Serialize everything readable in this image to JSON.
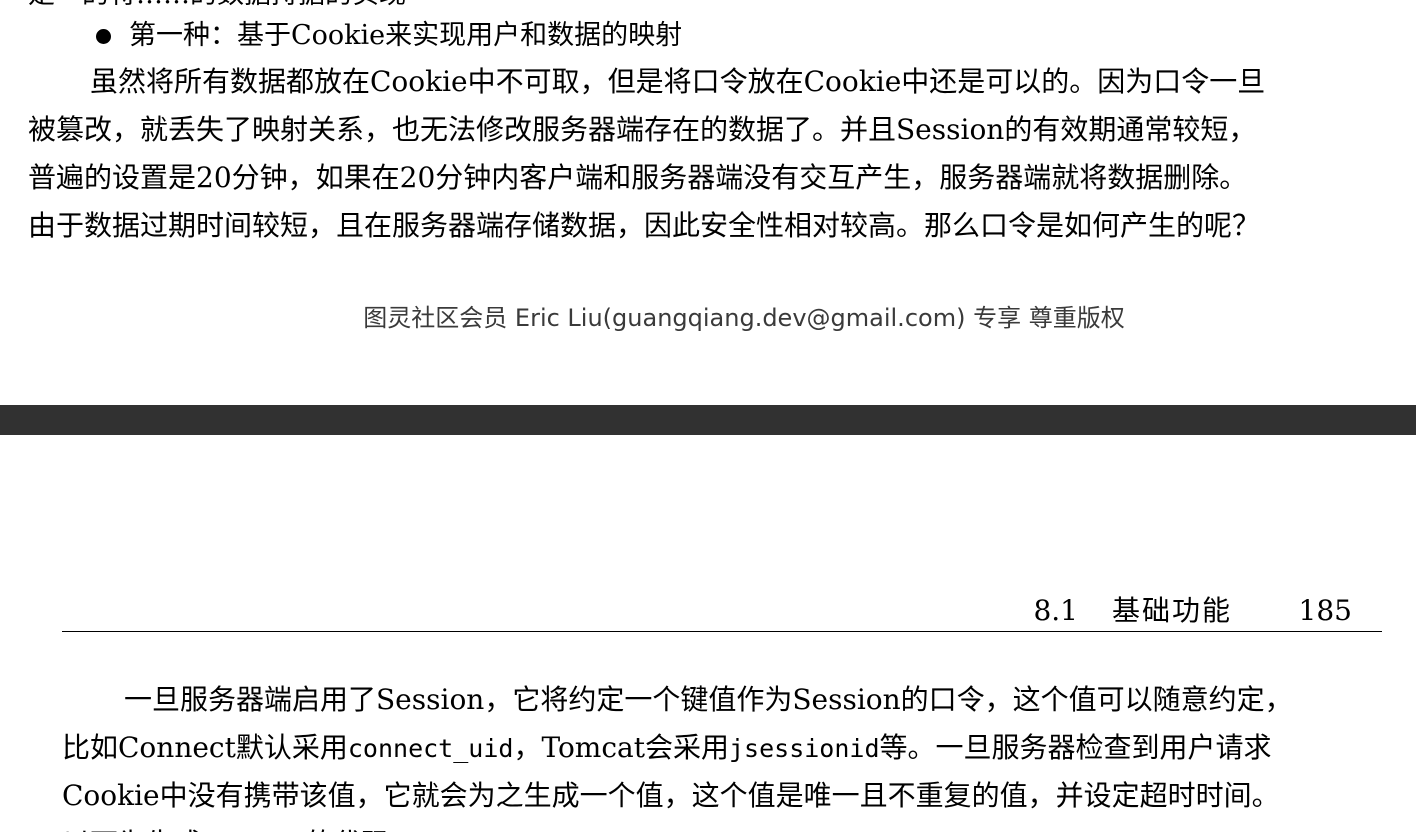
{
  "top_page": {
    "cut_line": "是一的将……的数据持据的实现",
    "bullet": "第一种：基于Cookie来实现用户和数据的映射",
    "paragraph": [
      "虽然将所有数据都放在Cookie中不可取，但是将口令放在Cookie中还是可以的。因为口令一旦",
      "被篡改，就丢失了映射关系，也无法修改服务器端存在的数据了。并且Session的有效期通常较短，",
      "普遍的设置是20分钟，如果在20分钟内客户端和服务器端没有交互产生，服务器端就将数据删除。",
      "由于数据过期时间较短，且在服务器端存储数据，因此安全性相对较高。那么口令是如何产生的呢？"
    ],
    "watermark": "图灵社区会员 Eric Liu(guangqiang.dev@gmail.com) 专享 尊重版权"
  },
  "bottom_page": {
    "header": {
      "section_number": "8.1",
      "section_title": "基础功能",
      "page_number": "185"
    },
    "line1": "一旦服务器端启用了Session，它将约定一个键值作为Session的口令，这个值可以随意约定，",
    "line2": {
      "part1": "比如Connect默认采用",
      "code1": "connect_uid",
      "part2": "，Tomcat会采用",
      "code2": "jsessionid",
      "part3": "等。一旦服务器检查到用户请求"
    },
    "line3": "Cookie中没有携带该值，它就会为之生成一个值，这个值是唯一且不重复的值，并设定超时时间。",
    "line4_cut": "以下为生成session的代码："
  },
  "colors": {
    "page_background": "#ffffff",
    "gap_background": "#313131",
    "text": "#000000",
    "watermark": "#3a3a3a"
  }
}
